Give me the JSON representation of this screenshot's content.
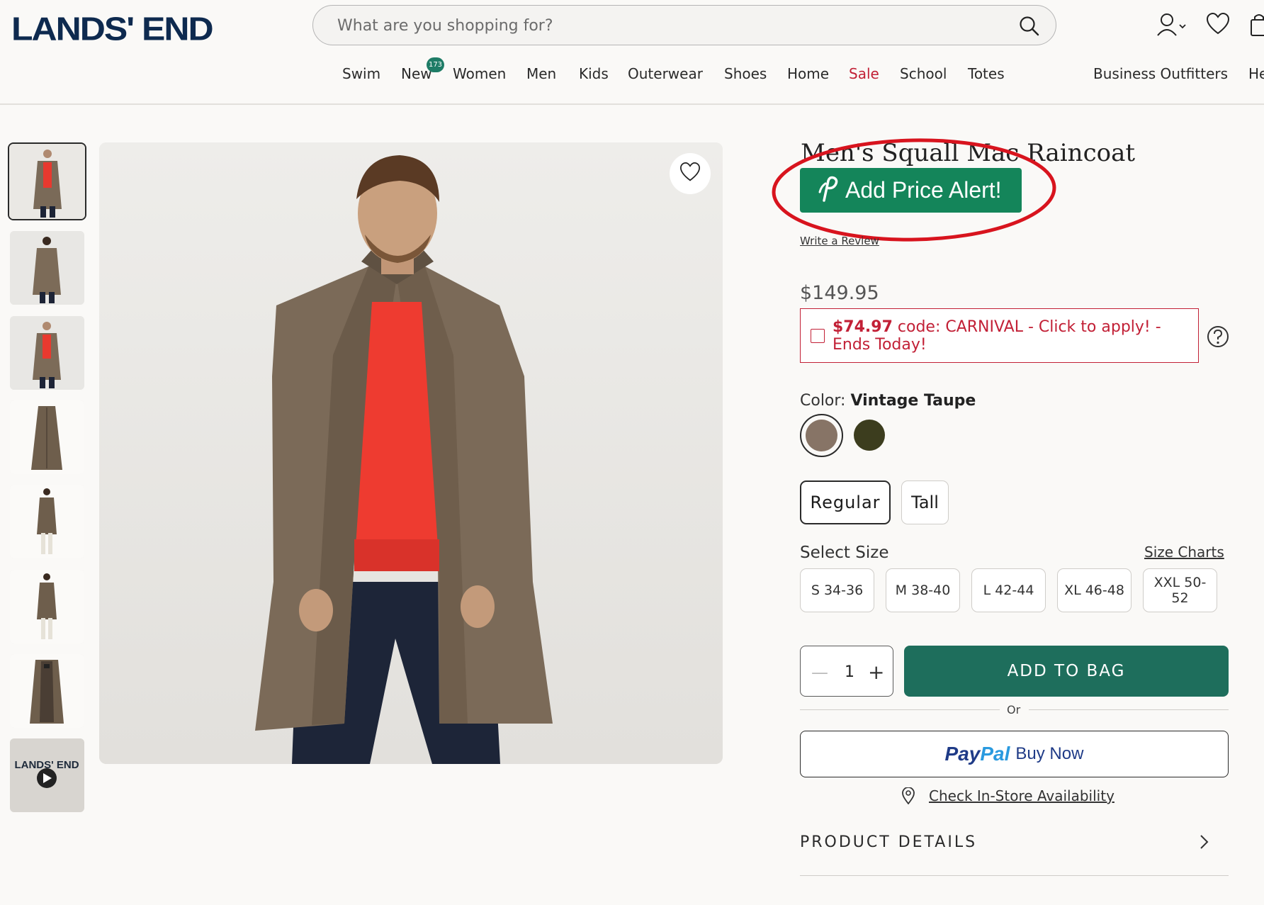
{
  "header": {
    "logo": "LANDS' END",
    "search_placeholder": "What are you shopping for?",
    "nav": [
      {
        "label": "Swim"
      },
      {
        "label": "New",
        "badge": "173"
      },
      {
        "label": "Women"
      },
      {
        "label": "Men"
      },
      {
        "label": "Kids"
      },
      {
        "label": "Outerwear"
      },
      {
        "label": "Shoes"
      },
      {
        "label": "Home"
      },
      {
        "label": "Sale",
        "color": "#c22036"
      },
      {
        "label": "School"
      },
      {
        "label": "Totes"
      },
      {
        "label": "Business Outfitters"
      },
      {
        "label": "He"
      }
    ]
  },
  "thumbnails": {
    "count": 8,
    "selected_index": 0,
    "video_thumb_text": "LANDS' END"
  },
  "product": {
    "title": "Men's Squall Mac Raincoat",
    "price_alert_label": "Add Price Alert!",
    "write_review": "Write a Review",
    "price": "$149.95",
    "promo": {
      "price": "$74.97",
      "text": " code: CARNIVAL - Click to apply! - Ends Today!"
    },
    "color_label": "Color:",
    "color_value": "Vintage Taupe",
    "swatches": [
      {
        "name": "Vintage Taupe",
        "hex": "#877466",
        "selected": true
      },
      {
        "name": "Olive",
        "hex": "#3c3d1e",
        "selected": false
      }
    ],
    "fits": [
      {
        "label": "Regular",
        "selected": true
      },
      {
        "label": "Tall",
        "selected": false
      }
    ],
    "select_size_label": "Select Size",
    "size_charts_label": "Size Charts",
    "sizes": [
      "S 34-36",
      "M 38-40",
      "L 42-44",
      "XL 46-48",
      "XXL 50-52"
    ],
    "quantity": "1",
    "add_to_bag": "ADD TO BAG",
    "or_label": "Or",
    "paypal": {
      "logo_a": "Pay",
      "logo_b": "Pal",
      "buy_now": "Buy Now"
    },
    "store_availability": "Check In-Store Availability",
    "product_details": "PRODUCT DETAILS"
  },
  "colors": {
    "brand_navy": "#0e2a4f",
    "accent_green": "#1e6e5c",
    "alert_green": "#14855a",
    "sale_red": "#c22036",
    "annotation_red": "#d8141e"
  },
  "icons": [
    "search-icon",
    "account-icon",
    "heart-icon",
    "bag-icon",
    "help-icon",
    "location-pin-icon",
    "chevron-right-icon",
    "play-icon",
    "price-alert-logo-icon"
  ]
}
